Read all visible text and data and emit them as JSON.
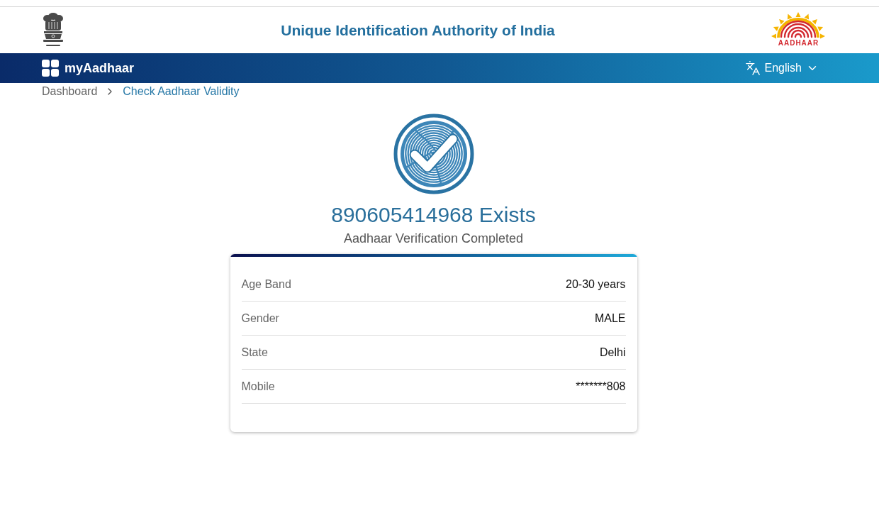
{
  "header": {
    "title": "Unique Identification Authority of India",
    "logo_text": "AADHAAR"
  },
  "navbar": {
    "brand": "myAadhaar",
    "language": "English"
  },
  "breadcrumb": [
    {
      "label": "Dashboard",
      "selected": false
    },
    {
      "label": "Check Aadhaar Validity",
      "selected": true
    }
  ],
  "result": {
    "heading": "890605414968 Exists",
    "subtitle": "Aadhaar Verification Completed"
  },
  "details": [
    {
      "label": "Age Band",
      "value": "20-30 years"
    },
    {
      "label": "Gender",
      "value": "MALE"
    },
    {
      "label": "State",
      "value": "Delhi"
    },
    {
      "label": "Mobile",
      "value": "*******808"
    }
  ]
}
